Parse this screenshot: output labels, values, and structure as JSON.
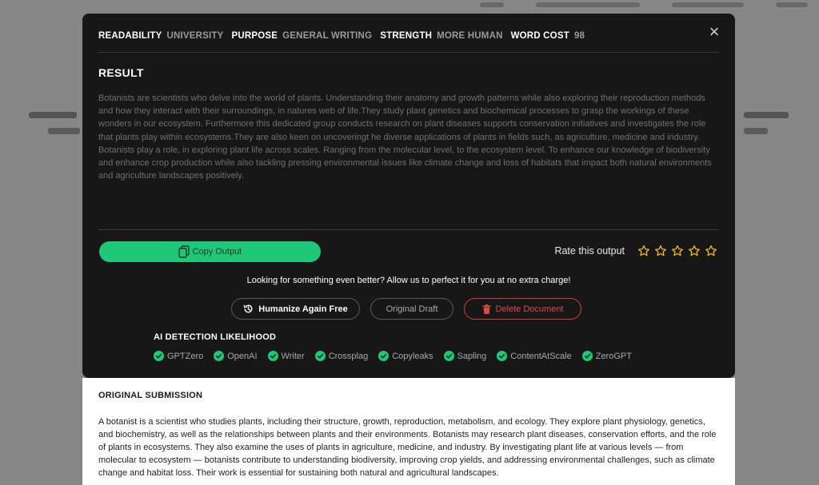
{
  "meta": {
    "readability_label": "READABILITY",
    "readability_value": "UNIVERSITY",
    "purpose_label": "PURPOSE",
    "purpose_value": "GENERAL WRITING",
    "strength_label": "STRENGTH",
    "strength_value": "MORE HUMAN",
    "word_cost_label": "WORD COST",
    "word_cost_value": "98"
  },
  "close_icon": "×",
  "result": {
    "title": "RESULT",
    "text": "Botanists are scientists who delve into the world of plants. Understanding their anatomy and growth patterns while also exploring their reproduction methods and how they interact with their surroundings, in natures web of life.They study plant genetics and biochemical processes to grasp the workings of these wonders in our ecosystem. Furthermore this dedicated group conducts research on plant diseases supports conservation initiatives and investigates the role that plants play within ecosystems.They are also keen on uncoveringt he diverse applications of plants in fields such, as agriculture, medicine and industry. Botanists play a role, in exploring plant life across scales. Ranging from the molecular level, to the ecosystem level. To enhance our knowledge of biodiversity and enhance crop production while also tackling pressing environmental issues like climate change and loss of habitats that impact both natural environments and agriculture landscapes positively."
  },
  "copy_button": "Copy Output",
  "rating": {
    "label": "Rate this output",
    "max_stars": 5,
    "star_color": "#f2b51d"
  },
  "promo_text": "Looking for something even better? Allow us to perfect it for you at no extra charge!",
  "actions": {
    "humanize": "Humanize Again Free",
    "draft": "Original Draft",
    "delete": "Delete Document"
  },
  "ai_detection": {
    "title": "AI DETECTION LIKELIHOOD",
    "check_color": "#1ec878",
    "detectors": [
      "GPTZero",
      "OpenAI",
      "Writer",
      "Crossplag",
      "Copyleaks",
      "Sapling",
      "ContentAtScale",
      "ZeroGPT"
    ]
  },
  "original": {
    "title": "ORIGINAL SUBMISSION",
    "text": "A botanist is a scientist who studies plants, including their structure, growth, reproduction, metabolism, and ecology. They explore plant physiology, genetics, and biochemistry, as well as the relationships between plants and their environments. Botanists may research plant diseases, conservation efforts, and the role of plants in ecosystems. They also examine the uses of plants in agriculture, medicine, and industry. By investigating plant life at various levels — from molecular to ecosystem — botanists contribute to understanding biodiversity, improving crop yields, and addressing environmental challenges, such as climate change and habitat loss. Their work is essential for sustaining both natural and agricultural landscapes."
  },
  "colors": {
    "accent_green": "#1ec878",
    "delete_red": "#e04848",
    "modal_bg": "#171717"
  }
}
